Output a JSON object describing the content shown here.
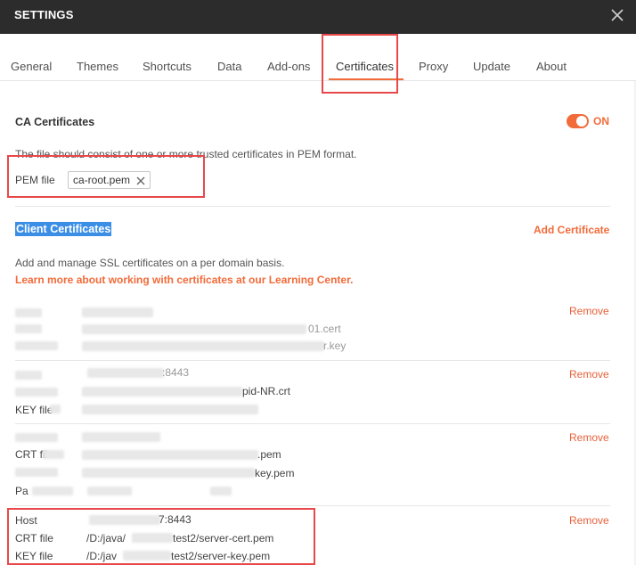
{
  "window": {
    "title": "SETTINGS"
  },
  "tabs": [
    {
      "label": "General"
    },
    {
      "label": "Themes"
    },
    {
      "label": "Shortcuts"
    },
    {
      "label": "Data"
    },
    {
      "label": "Add-ons"
    },
    {
      "label": "Certificates"
    },
    {
      "label": "Proxy"
    },
    {
      "label": "Update"
    },
    {
      "label": "About"
    }
  ],
  "ca": {
    "title": "CA Certificates",
    "toggle_label": "ON",
    "description": "The file should consist of one or more trusted certificates in PEM format.",
    "pem_label": "PEM file",
    "pem_value": "ca-root.pem"
  },
  "client": {
    "title": "Client Certificates",
    "add_label": "Add Certificate",
    "description": "Add and manage SSL certificates on a per domain basis.",
    "learn_more": "Learn more about working with certificates at our Learning Center.",
    "remove_label": "Remove",
    "entries": [
      {
        "frag1": "01.cert",
        "frag2": "r.key"
      },
      {
        "host_frag": ":8443",
        "crt_frag": "pid-NR.crt",
        "key_label": "KEY file"
      },
      {
        "crt_label": "CRT fil",
        "crt_frag": ".pem",
        "key_frag": "key.pem",
        "pa_label": "Pa"
      }
    ],
    "last": {
      "host_label": "Host",
      "host_value": "7:8443",
      "crt_label": "CRT file",
      "crt_pre": "/D:/java/",
      "crt_post": "test2/server-cert.pem",
      "key_label": "KEY file",
      "key_pre": "/D:/jav",
      "key_post": "test2/server-key.pem"
    }
  },
  "colors": {
    "accent": "#f26b3a",
    "highlight": "#e8484a",
    "selection": "#3a8ee6",
    "titlebar": "#2c2c2c"
  }
}
